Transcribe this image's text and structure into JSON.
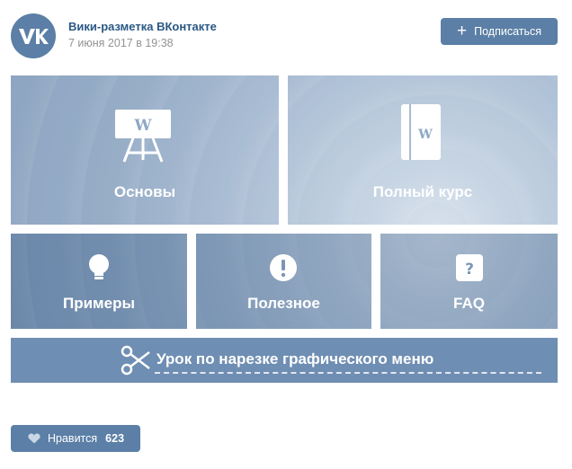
{
  "post": {
    "author": "Вики-разметка ВКонтакте",
    "date": "7 июня 2017 в 19:38",
    "avatar_icon": "vk-logo-icon"
  },
  "subscribe_button": {
    "icon": "plus-icon",
    "label": "Подписаться"
  },
  "menu": {
    "colors": {
      "accent": "#5b7fa6",
      "link": "#2a5885",
      "muted": "#939393"
    },
    "tiles": [
      {
        "label": "Основы",
        "icon": "easel-w-icon"
      },
      {
        "label": "Полный курс",
        "icon": "book-w-icon"
      },
      {
        "label": "Примеры",
        "icon": "lightbulb-icon"
      },
      {
        "label": "Полезное",
        "icon": "exclamation-circle-icon"
      },
      {
        "label": "FAQ",
        "icon": "question-square-icon"
      }
    ],
    "banner": {
      "label": "Урок по нарезке графического меню",
      "icon": "scissors-icon"
    }
  },
  "like_button": {
    "icon": "heart-icon",
    "label": "Нравится",
    "count": "623"
  }
}
